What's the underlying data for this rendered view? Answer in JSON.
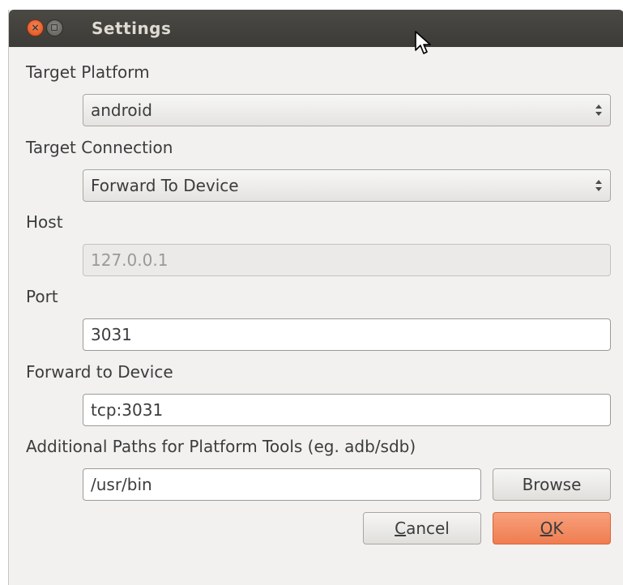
{
  "window": {
    "title": "Settings",
    "close_glyph": "×"
  },
  "form": {
    "target_platform": {
      "label": "Target Platform",
      "value": "android"
    },
    "target_connection": {
      "label": "Target Connection",
      "value": "Forward To Device"
    },
    "host": {
      "label": "Host",
      "value": "127.0.0.1",
      "enabled": false
    },
    "port": {
      "label": "Port",
      "value": "3031"
    },
    "forward_to_device": {
      "label": "Forward to Device",
      "value": "tcp:3031"
    },
    "additional_paths": {
      "label": "Additional Paths for Platform Tools (eg. adb/sdb)",
      "value": "/usr/bin",
      "browse_label": "Browse"
    }
  },
  "buttons": {
    "cancel_mnemonic": "C",
    "cancel_rest": "ancel",
    "ok_mnemonic": "O",
    "ok_rest": "K"
  },
  "colors": {
    "titlebar": "#3c3b37",
    "close_button": "#df4b16",
    "ok_button": "#ef7d50",
    "window_bg": "#f2f1f0"
  },
  "icons": {
    "close": "close-icon",
    "minimize": "minimize-icon",
    "combo_arrows": "up-down-arrows-icon",
    "cursor": "mouse-pointer-icon"
  }
}
